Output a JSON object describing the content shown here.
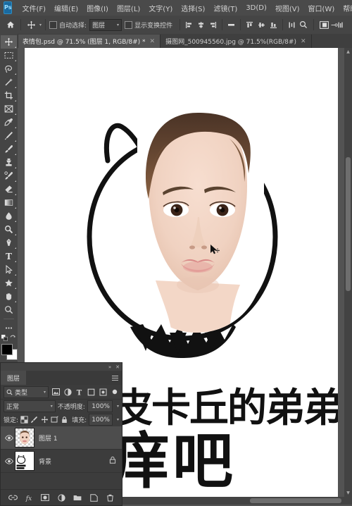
{
  "app": {
    "logo_glyph": "Ps",
    "menus": [
      {
        "label": "文件(F)"
      },
      {
        "label": "编辑(E)"
      },
      {
        "label": "图像(I)"
      },
      {
        "label": "图层(L)"
      },
      {
        "label": "文字(Y)"
      },
      {
        "label": "选择(S)"
      },
      {
        "label": "滤镜(T)"
      },
      {
        "label": "3D(D)"
      },
      {
        "label": "视图(V)"
      },
      {
        "label": "窗口(W)"
      },
      {
        "label": "帮助(H)"
      }
    ],
    "window_buttons": {
      "minimize": "—",
      "maximize": "❐",
      "close": "✕"
    }
  },
  "options_bar": {
    "home_icon": "home-icon",
    "tool_icon": "move-tool-icon",
    "auto_select_label": "自动选择:",
    "auto_select_checked": false,
    "auto_select_target": "图层",
    "show_transform_label": "显示变换控件",
    "show_transform_checked": false,
    "align_icons": [
      "align-left-icon",
      "align-center-horizontal-icon",
      "align-right-icon",
      "distribute-horizontal-icon",
      "align-top-icon",
      "align-middle-vertical-icon",
      "align-bottom-icon"
    ],
    "extra_icons": [
      "distribute-icon",
      "search-icon",
      "arrange-documents-icon",
      "workspace-icon"
    ]
  },
  "tabs": [
    {
      "title": "表情包.psd @ 71.5% (图层 1, RGB/8#) *",
      "active": true,
      "close": "✕"
    },
    {
      "title": "摄图网_500945560.jpg @ 71.5%(RGB/8#)",
      "active": false,
      "close": "✕"
    }
  ],
  "toolbar": {
    "tools": [
      {
        "name": "move-tool",
        "selected": true
      },
      {
        "name": "rectangular-marquee-tool",
        "selected": false
      },
      {
        "name": "lasso-tool",
        "selected": false
      },
      {
        "name": "magic-wand-tool",
        "selected": false
      },
      {
        "name": "crop-tool",
        "selected": false
      },
      {
        "name": "frame-tool",
        "selected": false
      },
      {
        "name": "eyedropper-tool",
        "selected": false
      },
      {
        "name": "spot-healing-brush-tool",
        "selected": false
      },
      {
        "name": "brush-tool",
        "selected": false
      },
      {
        "name": "clone-stamp-tool",
        "selected": false
      },
      {
        "name": "history-brush-tool",
        "selected": false
      },
      {
        "name": "eraser-tool",
        "selected": false
      },
      {
        "name": "gradient-tool",
        "selected": false
      },
      {
        "name": "blur-tool",
        "selected": false
      },
      {
        "name": "dodge-tool",
        "selected": false
      },
      {
        "name": "pen-tool",
        "selected": false
      },
      {
        "name": "type-tool",
        "selected": false
      },
      {
        "name": "path-selection-tool",
        "selected": false
      },
      {
        "name": "custom-shape-tool",
        "selected": false
      },
      {
        "name": "hand-tool",
        "selected": false
      },
      {
        "name": "zoom-tool",
        "selected": false
      },
      {
        "name": "edit-toolbar-tool",
        "selected": false
      }
    ],
    "foreground_color": "#000000",
    "background_color": "#ffffff",
    "quick_mask_icon": "quick-mask-icon"
  },
  "canvas": {
    "zoom_level": "71.5%",
    "artwork_description": "cat-outline-sticker-with-face-photo",
    "text_line_1": "你是皮卡丘的弟弟",
    "text_line_2": "在痒吧",
    "background_color": "#ffffff",
    "outline_color": "#111111",
    "cursor_icon": "move-cursor-icon"
  },
  "layers_panel": {
    "tab_label": "图层",
    "collapse_icon": "»",
    "close_icon": "✕",
    "menu_icon": "panel-menu-icon",
    "filter": {
      "search_icon": "search-icon",
      "kind_label": "类型",
      "caret": "▾",
      "icons": [
        "pixel-filter-icon",
        "adjustment-filter-icon",
        "type-filter-icon",
        "shape-filter-icon",
        "smart-object-filter-icon"
      ],
      "toggle_icon": "filter-toggle-icon"
    },
    "blend_mode": "正常",
    "blend_caret": "▾",
    "opacity_label": "不透明度:",
    "opacity_value": "100%",
    "lock_label": "锁定:",
    "lock_icons": [
      "lock-transparent-pixels-icon",
      "lock-image-pixels-icon",
      "lock-position-icon",
      "lock-artboard-icon",
      "lock-all-icon"
    ],
    "fill_label": "填充:",
    "fill_value": "100%",
    "layers": [
      {
        "name": "图层 1",
        "visible": true,
        "selected": true,
        "locked": false,
        "thumb": "face-photo",
        "eye": "●"
      },
      {
        "name": "背景",
        "visible": true,
        "selected": false,
        "locked": true,
        "thumb": "sticker-artwork",
        "eye": "●",
        "lock_glyph": "🔒"
      }
    ],
    "bottom_buttons": [
      {
        "name": "link-layers-button",
        "glyph": "∞"
      },
      {
        "name": "layer-style-button",
        "glyph": "fx"
      },
      {
        "name": "layer-mask-button",
        "glyph": "▣"
      },
      {
        "name": "adjustment-layer-button",
        "glyph": "◒"
      },
      {
        "name": "new-group-button",
        "glyph": "▤"
      },
      {
        "name": "new-layer-button",
        "glyph": "⊡"
      },
      {
        "name": "delete-layer-button",
        "glyph": "🗑"
      }
    ]
  },
  "scrollbars": {
    "vertical_up": "▲",
    "vertical_down": "▼",
    "horizontal_left": "◀",
    "horizontal_right": "▶"
  }
}
